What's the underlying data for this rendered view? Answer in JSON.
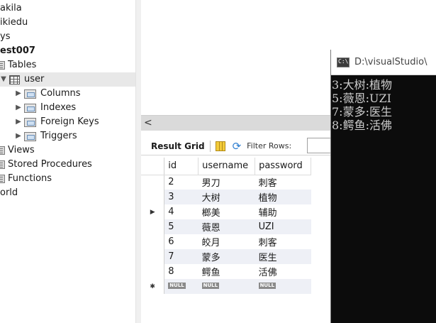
{
  "tree": {
    "items": [
      {
        "label": "akila"
      },
      {
        "label": "ikiedu"
      },
      {
        "label": "ys"
      },
      {
        "label": "est007"
      },
      {
        "label": "Tables"
      },
      {
        "label": "user"
      },
      {
        "label": "Columns"
      },
      {
        "label": "Indexes"
      },
      {
        "label": "Foreign Keys"
      },
      {
        "label": "Triggers"
      },
      {
        "label": "Views"
      },
      {
        "label": "Stored Procedures"
      },
      {
        "label": "Functions"
      },
      {
        "label": "orld"
      }
    ]
  },
  "toolbar": {
    "scroll_left": "<",
    "result_grid_label": "Result Grid",
    "filter_label": "Filter Rows:"
  },
  "grid": {
    "columns": [
      "id",
      "username",
      "password"
    ],
    "rows": [
      [
        "2",
        "男刀",
        "刺客"
      ],
      [
        "3",
        "大树",
        "植物"
      ],
      [
        "4",
        "榔美",
        "辅助"
      ],
      [
        "5",
        "薇恩",
        "UZI"
      ],
      [
        "6",
        "皎月",
        "刺客"
      ],
      [
        "7",
        "蒙多",
        "医生"
      ],
      [
        "8",
        "鳄鱼",
        "活佛"
      ]
    ],
    "current_row_marker": "▶",
    "new_row_marker": "✱",
    "null_label": "NULL"
  },
  "console": {
    "title": "D:\\visualStudio\\",
    "lines": [
      "3:大树:植物",
      "5:薇恩:UZI",
      "7:蒙多:医生",
      "8:鳄鱼:活佛"
    ]
  }
}
